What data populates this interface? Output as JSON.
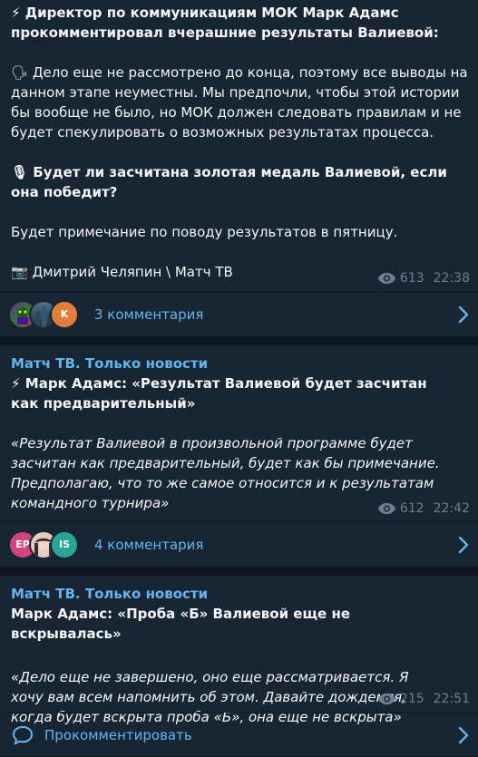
{
  "post1": {
    "headline_icon": "⚡",
    "headline": "Директор по коммуникациям МОК Марк Адамс прокомментировал вчерашние результаты Валиевой:",
    "quote_icon": "🗣",
    "quote": "Дело еще не рассмотрено до конца, поэтому все выводы на данном этапе неуместны. Мы предпочли, чтобы этой истории бы вообще не было, но МОК должен следовать правилам и не будет спекулировать о возможных результатах процесса.",
    "question_icon": "🎙",
    "question": "Будет ли засчитана золотая медаль Валиевой, если она победит?",
    "answer": "Будет примечание по поводу результатов в пятницу.",
    "credit_icon": "📷",
    "credit": "Дмитрий Челяпин \\ Матч ТВ",
    "views": "613",
    "time": "22:38",
    "comments_label": "3 комментария",
    "avatar_letters": [
      "",
      "",
      "K"
    ],
    "avatar_icons": [
      "avatar-image-1",
      "avatar-image-2",
      "avatar-letter-k"
    ]
  },
  "post2": {
    "sender": "Матч ТВ. Только новости",
    "headline_icon": "⚡",
    "headline": "Марк Адамс: «Результат Валиевой будет засчитан как предварительный»",
    "quote": "«Результат Валиевой в произвольной программе будет засчитан как  предварительный, будет как бы примечание. Предполагаю, что то же самое относится и к результатам командного турнира»",
    "views": "612",
    "time": "22:42",
    "comments_label": "4 комментария",
    "avatar_letters": [
      "EP",
      "",
      "IS"
    ]
  },
  "post3": {
    "sender": "Матч ТВ. Только новости",
    "headline": "Марк Адамс: «Проба «Б» Валиевой еще не вскрывалась»",
    "quote": "«Дело еще не завершено, оно еще рассматривается. Я хочу вам всем напомнить об этом. Давайте дождемся, когда будет вскрыта проба «Б», она еще не вскрыта»",
    "views": "215",
    "time": "22:51",
    "comment_cta": "Прокомментировать"
  },
  "colors": {
    "background": "#0e1621",
    "bubble": "#182533",
    "accent": "#64b5ef",
    "meta": "#6d7f8f"
  }
}
